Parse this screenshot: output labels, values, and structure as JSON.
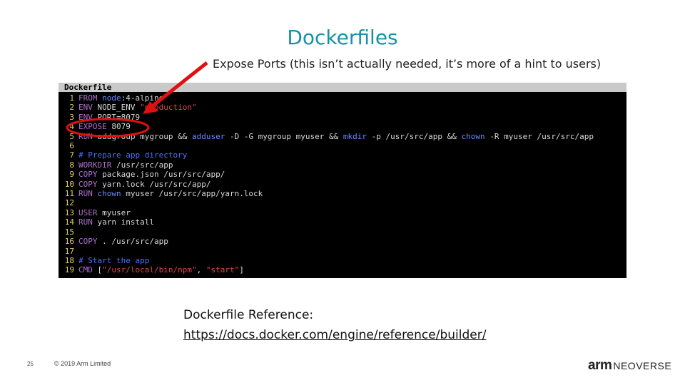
{
  "title": "Dockerfiles",
  "subtitle": "Expose Ports (this isn’t actually needed, it’s more of a hint to users)",
  "terminal": {
    "header": "Dockerfile",
    "lines": [
      {
        "n": "1",
        "t": "FROM node:4-alpine"
      },
      {
        "n": "2",
        "t": "ENV NODE_ENV \"production\""
      },
      {
        "n": "3",
        "t": "ENV PORT=8079"
      },
      {
        "n": "4",
        "t": "EXPOSE 8079"
      },
      {
        "n": "5",
        "t": "RUN addgroup mygroup && adduser -D -G mygroup myuser && mkdir -p /usr/src/app && chown -R myuser /usr/src/app"
      },
      {
        "n": "6",
        "t": ""
      },
      {
        "n": "7",
        "t": "# Prepare app directory"
      },
      {
        "n": "8",
        "t": "WORKDIR /usr/src/app"
      },
      {
        "n": "9",
        "t": "COPY package.json /usr/src/app/"
      },
      {
        "n": "10",
        "t": "COPY yarn.lock /usr/src/app/"
      },
      {
        "n": "11",
        "t": "RUN chown myuser /usr/src/app/yarn.lock"
      },
      {
        "n": "12",
        "t": ""
      },
      {
        "n": "13",
        "t": "USER myuser"
      },
      {
        "n": "14",
        "t": "RUN yarn install"
      },
      {
        "n": "15",
        "t": ""
      },
      {
        "n": "16",
        "t": "COPY . /usr/src/app"
      },
      {
        "n": "17",
        "t": ""
      },
      {
        "n": "18",
        "t": "# Start the app"
      },
      {
        "n": "19",
        "t": "CMD [\"/usr/local/bin/npm\", \"start\"]"
      }
    ]
  },
  "reference": {
    "label": "Dockerfile Reference:",
    "url": "https://docs.docker.com/engine/reference/builder/"
  },
  "footer": {
    "page_number": "25",
    "copyright": "© 2019 Arm Limited",
    "logo_arm": "arm",
    "logo_neoverse": "NEOVERSE"
  },
  "colors": {
    "title": "#1a8fa8",
    "annotation": "#e01010"
  }
}
